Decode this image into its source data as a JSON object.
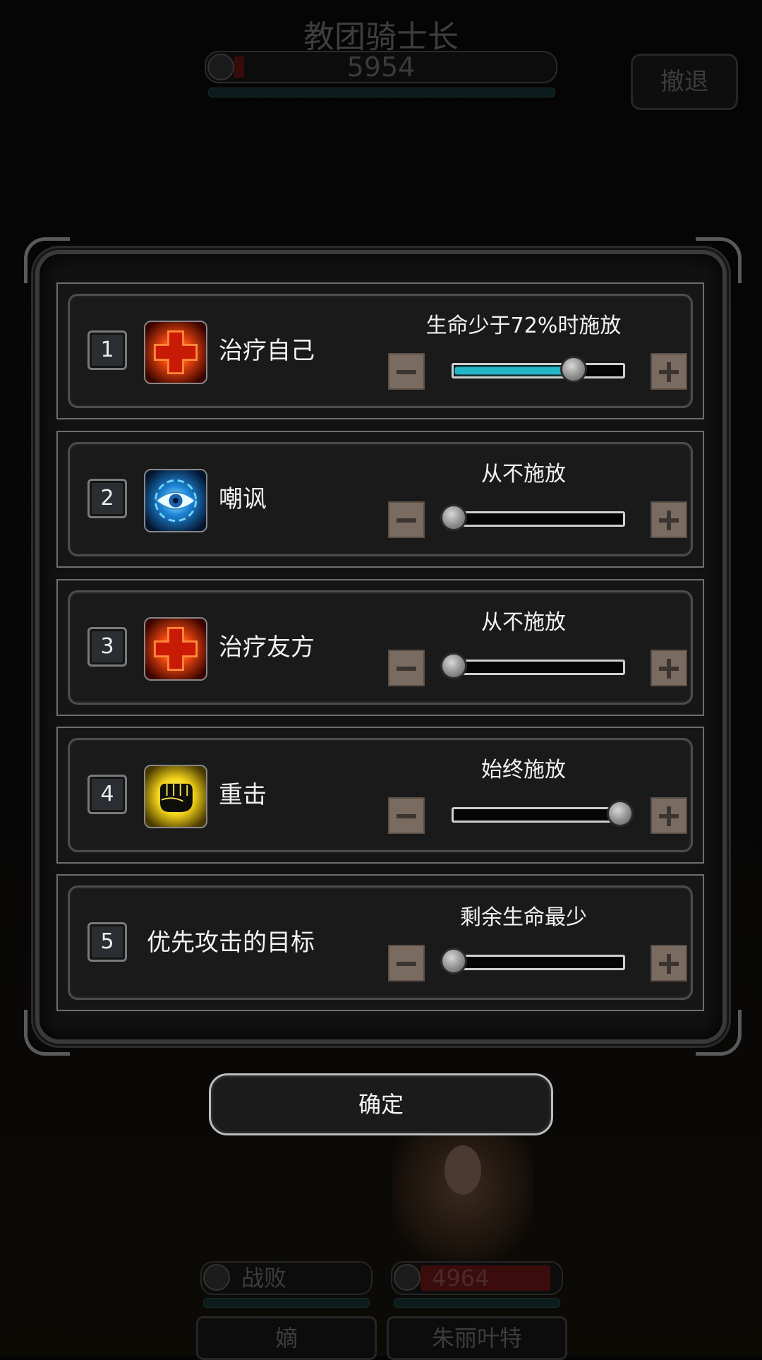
{
  "boss": {
    "name": "教团骑士长",
    "hp": "5954"
  },
  "retreat_label": "撤退",
  "skills": [
    {
      "index": "1",
      "name": "治疗自己",
      "icon": "red-cross-heal-icon",
      "condition": "生命少于72%时施放",
      "slider_value": 0.72
    },
    {
      "index": "2",
      "name": "嘲讽",
      "icon": "blue-eye-taunt-icon",
      "condition": "从不施放",
      "slider_value": 0
    },
    {
      "index": "3",
      "name": "治疗友方",
      "icon": "red-cross-heal-icon",
      "condition": "从不施放",
      "slider_value": 0
    },
    {
      "index": "4",
      "name": "重击",
      "icon": "fist-strike-icon",
      "condition": "始终施放",
      "slider_value": 1
    },
    {
      "index": "5",
      "name": "优先攻击的目标",
      "condition": "剩余生命最少",
      "slider_value": 0
    }
  ],
  "confirm_label": "确定",
  "party": [
    {
      "status": "战败",
      "name": "嫡"
    },
    {
      "status": "4964",
      "name": "朱丽叶特"
    }
  ],
  "colors": {
    "slider_fill": "#22b6c6",
    "step_button": "#7a6b60"
  }
}
